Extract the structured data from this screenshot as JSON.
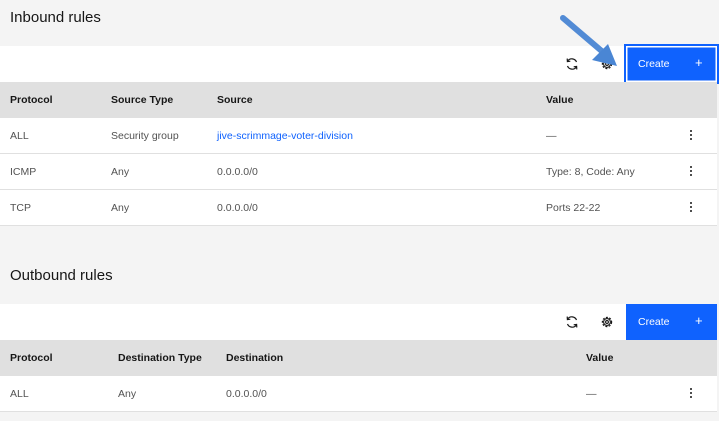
{
  "colors": {
    "primary": "#0f62fe",
    "header_bg": "#e0e0e0",
    "page_bg": "#f4f4f4",
    "link": "#0f62fe",
    "arrow": "#4a86d4"
  },
  "icons": {
    "refresh": "refresh-icon",
    "settings": "gear-icon",
    "overflow": "overflow-menu-icon",
    "add": "plus-icon",
    "pointer": "pointer-arrow"
  },
  "inbound": {
    "title": "Inbound rules",
    "create_label": "Create",
    "create_plus": "+",
    "columns": [
      "Protocol",
      "Source Type",
      "Source",
      "Value"
    ],
    "rows": [
      {
        "protocol": "ALL",
        "type": "Security group",
        "target": "jive-scrimmage-voter-division",
        "value": "—"
      },
      {
        "protocol": "ICMP",
        "type": "Any",
        "target": "0.0.0.0/0",
        "value": "Type: 8, Code: Any"
      },
      {
        "protocol": "TCP",
        "type": "Any",
        "target": "0.0.0.0/0",
        "value": "Ports 22-22"
      }
    ]
  },
  "outbound": {
    "title": "Outbound rules",
    "create_label": "Create",
    "create_plus": "+",
    "columns": [
      "Protocol",
      "Destination Type",
      "Destination",
      "Value"
    ],
    "rows": [
      {
        "protocol": "ALL",
        "type": "Any",
        "target": "0.0.0.0/0",
        "value": "—"
      }
    ]
  }
}
